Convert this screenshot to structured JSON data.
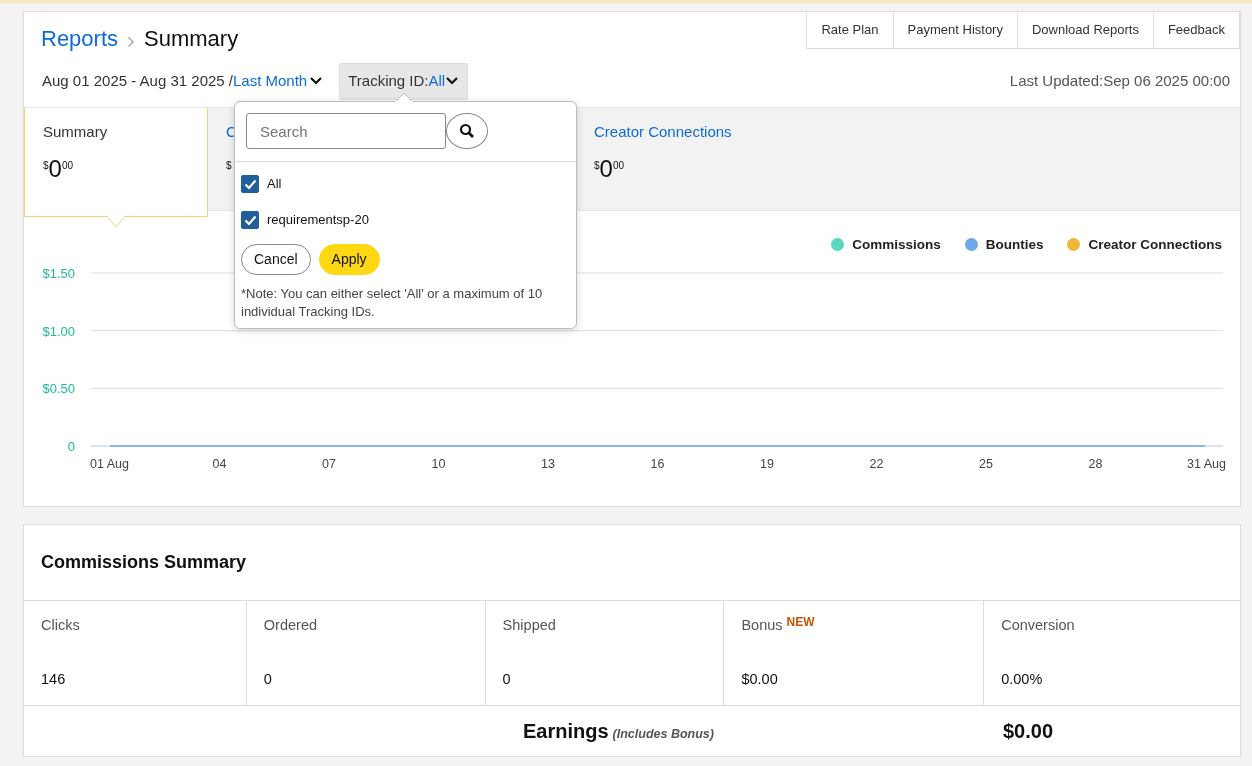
{
  "breadcrumb": {
    "parent": "Reports",
    "current": "Summary"
  },
  "top_links": [
    "Rate Plan",
    "Payment History",
    "Download Reports",
    "Feedback"
  ],
  "date_range": {
    "text": "Aug 01 2025 - Aug 31 2025 /",
    "preset": "Last Month"
  },
  "tracking_id": {
    "label": "Tracking ID:",
    "value": "All",
    "expanded": true
  },
  "last_updated": "Last Updated:Sep 06 2025 00:00",
  "tabs": [
    {
      "label": "Summary",
      "selected": true,
      "amount": {
        "currency": "$",
        "whole": "0",
        "cents": "00"
      }
    },
    {
      "label": "C",
      "selected": false,
      "amount": {
        "currency": "$"
      }
    },
    {
      "label": "Creator Connections",
      "selected": false,
      "amount": {
        "currency": "$",
        "whole": "0",
        "cents": "00"
      }
    }
  ],
  "tracking_dropdown": {
    "search": {
      "placeholder": "Search"
    },
    "options": [
      {
        "label": "All",
        "checked": true
      },
      {
        "label": "requirementsp-20",
        "checked": true
      }
    ],
    "buttons": [
      {
        "label": "Cancel",
        "kind": "secondary"
      },
      {
        "label": "Apply",
        "kind": "primary"
      }
    ],
    "note": "*Note: You can either select 'All' or a maximum of 10 individual Tracking IDs."
  },
  "chart": {
    "legend": [
      {
        "kind": "entry",
        "label": "Commissions",
        "color": "#5ad8bc"
      },
      {
        "kind": "series"
      },
      {
        "kind": "entry",
        "label": "Creator Connections",
        "color": "#f0b73a"
      }
    ],
    "chart_data": {
      "type": "line",
      "categories": [
        "01 Aug",
        "04",
        "07",
        "10",
        "13",
        "16",
        "19",
        "22",
        "25",
        "28",
        "31 Aug"
      ],
      "series": [
        {
          "name": "Bounties",
          "color": "#6fa6e6",
          "values": [
            0,
            0,
            0,
            0,
            0,
            0,
            0,
            0,
            0,
            0,
            0
          ]
        }
      ],
      "ylim": [
        0,
        1.5
      ],
      "yticks": [
        {
          "value": 0,
          "label": "0"
        },
        {
          "value": 0.5,
          "label": "$0.50"
        },
        {
          "value": 1,
          "label": "$1.00"
        },
        {
          "value": 1.5,
          "label": "$1.50"
        }
      ]
    }
  },
  "commissions_summary": {
    "title": "Commissions Summary",
    "columns": [
      {
        "label": "Clicks",
        "value": "146"
      },
      {
        "label": "Ordered",
        "value": "0"
      },
      {
        "label": "Shipped",
        "value": "0"
      },
      {
        "label": "Bonus",
        "badge": "NEW",
        "value": "$0.00"
      },
      {
        "label": "Conversion",
        "value": "0.00%"
      }
    ],
    "earnings": {
      "label": "Earnings",
      "note": "(Includes Bonus)",
      "value": "$0.00"
    }
  }
}
